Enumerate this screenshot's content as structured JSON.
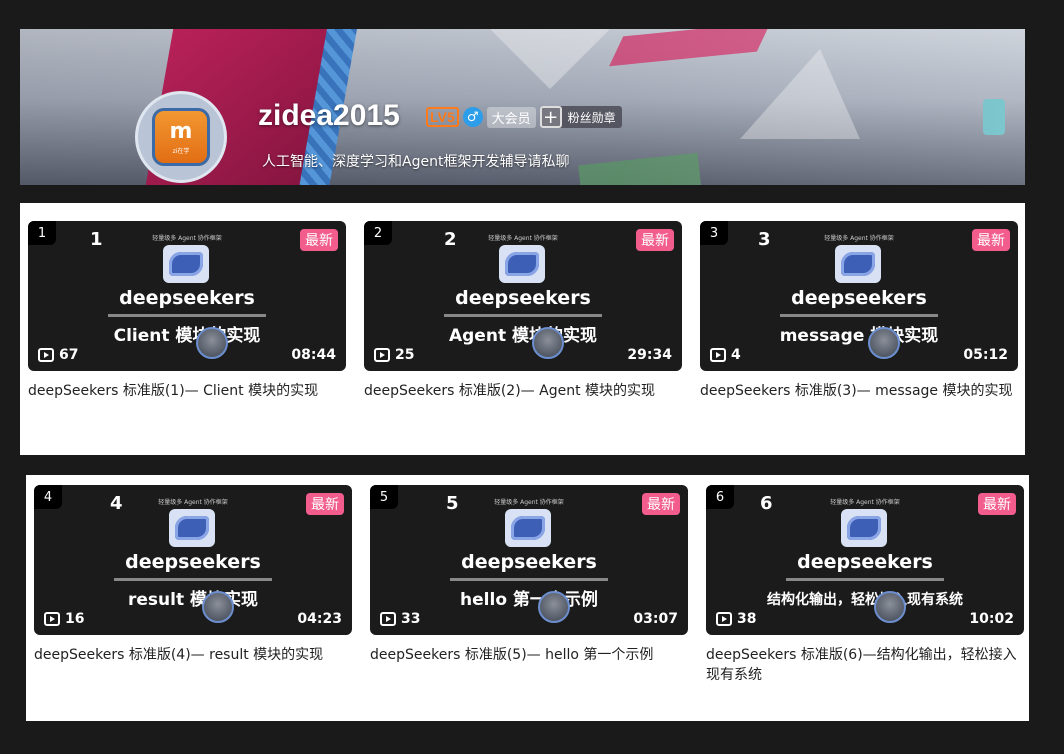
{
  "header": {
    "username": "zidea2015",
    "level": "LV5",
    "gender_icon": "male-icon",
    "vip_label": "大会员",
    "fans_badge_label": "粉丝勋章",
    "signature": "人工智能、深度学习和Agent框架开发辅导请私聊",
    "avatar_text": "zi在学"
  },
  "videos": [
    {
      "index": "1",
      "big_number": "1",
      "top_tiny": "轻量级多 Agent 协作框架",
      "badge": "最新",
      "brand": "deepseekers",
      "subtitle": "Client 模块的实现",
      "plays": "67",
      "duration": "08:44",
      "title": "deepSeekers 标准版(1)— Client 模块的实现"
    },
    {
      "index": "2",
      "big_number": "2",
      "top_tiny": "轻量级多 Agent 协作框架",
      "badge": "最新",
      "brand": "deepseekers",
      "subtitle": "Agent 模块的实现",
      "plays": "25",
      "duration": "29:34",
      "title": "deepSeekers 标准版(2)— Agent 模块的实现"
    },
    {
      "index": "3",
      "big_number": "3",
      "top_tiny": "轻量级多 Agent 协作框架",
      "badge": "最新",
      "brand": "deepseekers",
      "subtitle": "message 模块实现",
      "plays": "4",
      "duration": "05:12",
      "title": "deepSeekers 标准版(3)— message 模块的实现"
    },
    {
      "index": "4",
      "big_number": "4",
      "top_tiny": "轻量级多 Agent 协作框架",
      "badge": "最新",
      "brand": "deepseekers",
      "subtitle": "result 模块实现",
      "plays": "16",
      "duration": "04:23",
      "title": "deepSeekers 标准版(4)— result 模块的实现"
    },
    {
      "index": "5",
      "big_number": "5",
      "top_tiny": "轻量级多 Agent 协作框架",
      "badge": "最新",
      "brand": "deepseekers",
      "subtitle": "hello 第一个示例",
      "plays": "33",
      "duration": "03:07",
      "title": "deepSeekers 标准版(5)— hello 第一个示例"
    },
    {
      "index": "6",
      "big_number": "6",
      "top_tiny": "轻量级多 Agent 协作框架",
      "badge": "最新",
      "brand": "deepseekers",
      "subtitle": "结构化输出，轻松接入现有系统",
      "plays": "38",
      "duration": "10:02",
      "title": "deepSeekers 标准版(6)—结构化输出，轻松接入现有系统"
    }
  ],
  "colors": {
    "page_bg": "#1a1a1a",
    "new_badge": "#f25d8e",
    "level": "#ff7a1a",
    "gender": "#2c9de8"
  }
}
